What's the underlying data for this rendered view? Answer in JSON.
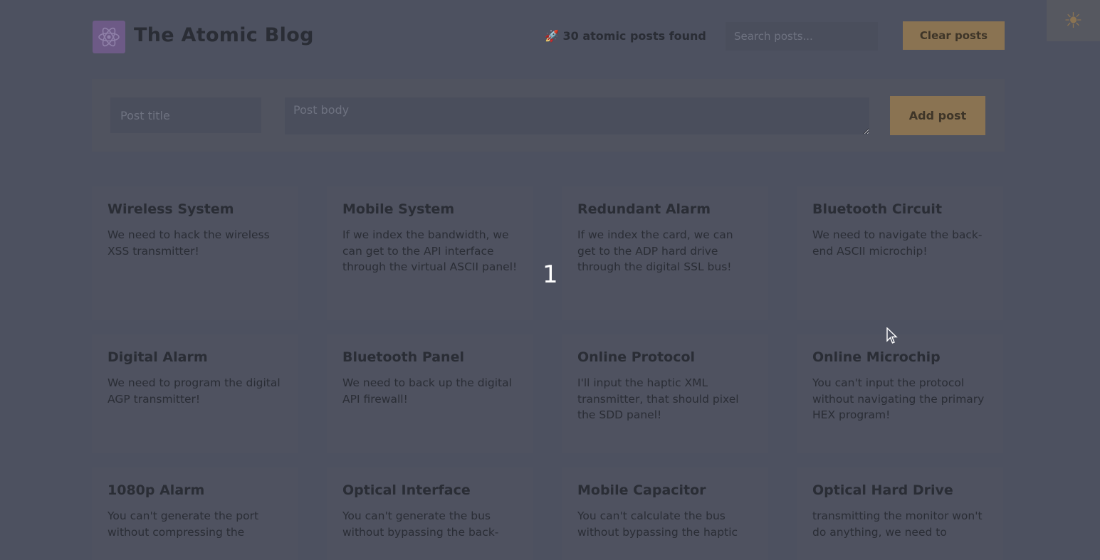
{
  "header": {
    "title": "The Atomic Blog",
    "results_text": "🚀 30 atomic posts found",
    "search_placeholder": "Search posts...",
    "clear_label": "Clear posts"
  },
  "form": {
    "title_placeholder": "Post title",
    "body_placeholder": "Post body",
    "add_label": "Add post"
  },
  "overlay_number": "1",
  "theme_toggle_icon": "sun-icon",
  "theme_toggle_glyph": "☀",
  "colors": {
    "background": "#4d5160",
    "accent": "#8a7352",
    "text": "#2a2d35",
    "logo": "#6d5a86"
  },
  "posts": [
    {
      "title": "Wireless System",
      "body": "We need to hack the wireless XSS transmitter!"
    },
    {
      "title": "Mobile System",
      "body": "If we index the bandwidth, we can get to the API interface through the virtual ASCII panel!"
    },
    {
      "title": "Redundant Alarm",
      "body": "If we index the card, we can get to the ADP hard drive through the digital SSL bus!"
    },
    {
      "title": "Bluetooth Circuit",
      "body": "We need to navigate the back-end ASCII microchip!"
    },
    {
      "title": "Digital Alarm",
      "body": "We need to program the digital AGP transmitter!"
    },
    {
      "title": "Bluetooth Panel",
      "body": "We need to back up the digital API firewall!"
    },
    {
      "title": "Online Protocol",
      "body": "I'll input the haptic XML transmitter, that should pixel the SDD panel!"
    },
    {
      "title": "Online Microchip",
      "body": "You can't input the protocol without navigating the primary HEX program!"
    },
    {
      "title": "1080p Alarm",
      "body": "You can't generate the port without compressing the"
    },
    {
      "title": "Optical Interface",
      "body": "You can't generate the bus without bypassing the back-"
    },
    {
      "title": "Mobile Capacitor",
      "body": "You can't calculate the bus without bypassing the haptic"
    },
    {
      "title": "Optical Hard Drive",
      "body": "transmitting the monitor won't do anything, we need to"
    }
  ]
}
